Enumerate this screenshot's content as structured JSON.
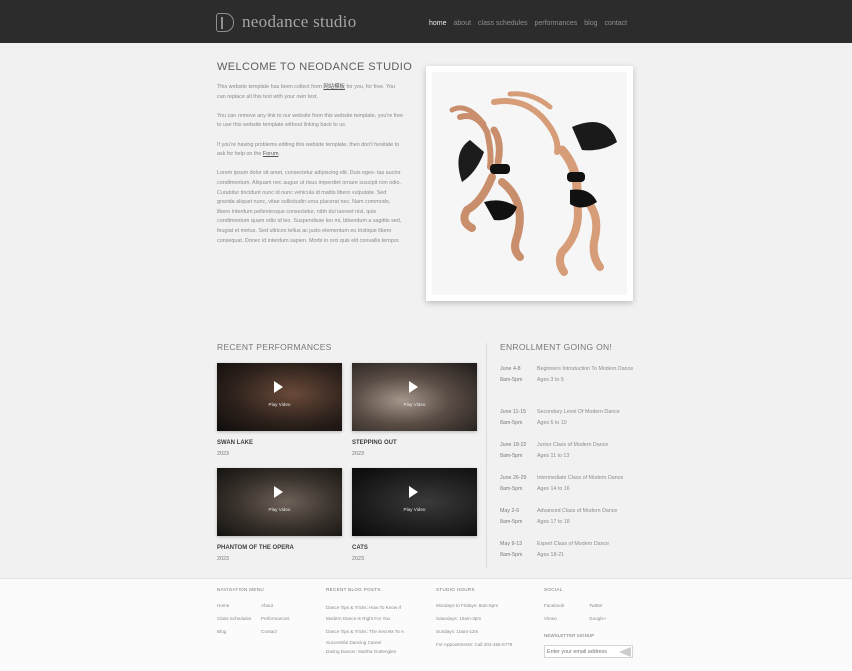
{
  "header": {
    "logo_text": "neodance studio",
    "nav": [
      {
        "label": "home",
        "active": true
      },
      {
        "label": "about",
        "active": false
      },
      {
        "label": "class schedules",
        "active": false
      },
      {
        "label": "performances",
        "active": false
      },
      {
        "label": "blog",
        "active": false
      },
      {
        "label": "contact",
        "active": false
      }
    ]
  },
  "intro": {
    "title": "WELCOME TO NEODANCE STUDIO",
    "p1_before": "This website template has been collect from ",
    "p1_link": "网站模板",
    "p1_after": " for you, for free. You can replace all this text with your own text.",
    "p2": "You can remove any link to our website from this website template, you're free to use this website template without linking back to us.",
    "p3_before": "If you're having problems editing this website template, then don't hesitate to ask for help on the ",
    "p3_link": "Forum",
    "p3_after": ".",
    "p4": "Lorem ipsum dolor sit amet, consectetur adipiscing elit. Duis eges- tas auctor condimentum. Aliquam nec augue ut risus imperdiet ornare suscipit non odio. Curabitur tincidunt nunc id nunc vehicula id mattis libero vulputate. Sed gravida aliquet nunc, vitae sollicitudin urna placerat nec. Nam commodo, libero interdum pellentesque consectetur, nibh dui laoreet nisl, quis condimentum quam odio id leo. Suspendisse leo mi, bibendum a sagittis sed, feugiat et metus. Sed ultrices tellus ac justo elementum eu tristique libero consequat. Donec id interdum sapien. Morbi in orci quis elit convallis tempor."
  },
  "performances": {
    "title": "RECENT PERFORMANCES",
    "play_label": "Play Video",
    "items": [
      {
        "title": "SWAN LAKE",
        "year": "2023"
      },
      {
        "title": "STEPPING OUT",
        "year": "2023"
      },
      {
        "title": "PHANTOM OF THE OPERA",
        "year": "2023"
      },
      {
        "title": "CATS",
        "year": "2023"
      }
    ]
  },
  "enrollment": {
    "title": "ENROLLMENT GOING ON!",
    "items": [
      {
        "dates": "June 4-8",
        "time": "8am-5pm",
        "course": "Beginners Introduction To Modern Dance",
        "ages": "Ages 3 to 5"
      },
      {
        "dates": "June 11-15",
        "time": "8am-5pm",
        "course": "Secondary Level Of Modern Dance",
        "ages": "Ages 6 to 10"
      },
      {
        "dates": "June 18-22",
        "time": "8am-5pm",
        "course": "Junior Class of Modern Dance",
        "ages": "Ages 11 to 13"
      },
      {
        "dates": "June 26-29",
        "time": "8am-5pm",
        "course": "Intermediate Class of Modern Dance",
        "ages": "Ages 14 to 16"
      },
      {
        "dates": "May 2-6",
        "time": "8am-5pm",
        "course": "Advanced Class of Modern Dance",
        "ages": "Ages 17 to 18"
      },
      {
        "dates": "May 9-13",
        "time": "8am-5pm",
        "course": "Expert Class of Modern Dance",
        "ages": "Ages 18-21"
      }
    ]
  },
  "footer": {
    "nav_title": "NAVIGATION MENU",
    "nav_links": [
      "Home",
      "About",
      "Class Schedules",
      "Performances",
      "Blog",
      "Contact"
    ],
    "blog_title": "RECENT BLOG POSTS",
    "blog_posts": [
      "Dance Tips & Tricks: How To Know If Modern Dance Is Right For You",
      "Dance Tips & Tricks: The Secrets To A Successful Dancing Career",
      "Daring Dancer: Martha Gottenglen"
    ],
    "hours_title": "STUDIO HOURS",
    "hours": [
      "Mondays to Fridays: 8am-5pm",
      "Saturdays: 10am-3pm",
      "Sundays: 10am-12m",
      "For Appointments: Call 202-456-6779"
    ],
    "social_title": "SOCIAL",
    "social_links": [
      "Facebook",
      "Twitter",
      "Vimeo",
      "Google+"
    ],
    "newsletter_title": "NEWSLETTER SIGNUP",
    "newsletter_placeholder": "Enter your email address"
  }
}
